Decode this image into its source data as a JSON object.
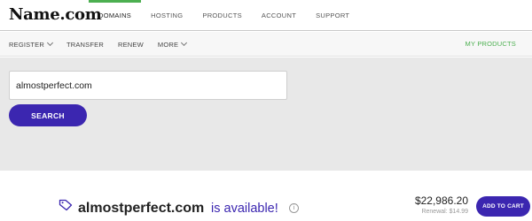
{
  "brand": {
    "logo": "Name.com"
  },
  "main_nav": {
    "items": [
      {
        "label": "DOMAINS",
        "active": true
      },
      {
        "label": "HOSTING",
        "active": false
      },
      {
        "label": "PRODUCTS",
        "active": false
      },
      {
        "label": "ACCOUNT",
        "active": false
      },
      {
        "label": "SUPPORT",
        "active": false
      }
    ]
  },
  "sub_nav": {
    "items": [
      {
        "label": "REGISTER",
        "has_dropdown": true
      },
      {
        "label": "TRANSFER",
        "has_dropdown": false
      },
      {
        "label": "RENEW",
        "has_dropdown": false
      },
      {
        "label": "MORE",
        "has_dropdown": true
      }
    ],
    "right_link": "MY PRODUCTS"
  },
  "search": {
    "value": "almostperfect.com",
    "button_label": "SEARCH"
  },
  "result": {
    "domain": "almostperfect.com",
    "availability_text": "is available!",
    "price": "$22,986.20",
    "renewal": "Renewal: $14.99",
    "add_to_cart_label": "ADD TO CART",
    "icons": {
      "tag": "tag-icon",
      "info": "info-icon"
    }
  },
  "colors": {
    "accent_green": "#4caf50",
    "primary_purple": "#3b26b0",
    "search_band": "#e8e8e8"
  }
}
